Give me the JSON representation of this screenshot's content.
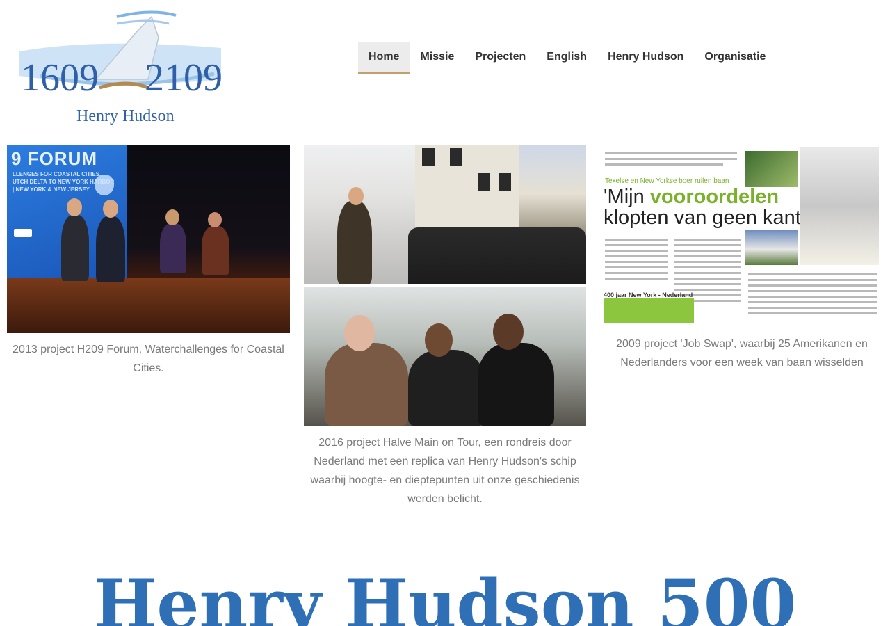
{
  "header": {
    "logo": {
      "year_left": "1609",
      "year_right": "2109",
      "name": "Henry Hudson"
    }
  },
  "nav": {
    "items": [
      {
        "label": "Home",
        "active": true
      },
      {
        "label": "Missie",
        "active": false
      },
      {
        "label": "Projecten",
        "active": false
      },
      {
        "label": "English",
        "active": false
      },
      {
        "label": "Henry Hudson",
        "active": false
      },
      {
        "label": "Organisatie",
        "active": false
      }
    ],
    "accent_color": "#c3a06b"
  },
  "gallery": [
    {
      "caption": "2013 project H209 Forum, Waterchallenges for Coastal Cities.",
      "photo_text": {
        "screen_title": "9 FORUM",
        "screen_sub": "LLENGES FOR COASTAL CITIES\nUTCH DELTA TO NEW YORK HARBOR\n| NEW YORK & NEW JERSEY"
      }
    },
    {
      "caption": "2016 project Halve Main on Tour, een rondreis door Nederland met een replica van Henry Hudson's schip waarbij hoogte- en dieptepunten uit onze geschiedenis werden belicht."
    },
    {
      "caption": "2009 project 'Job Swap', waarbij 25 Amerikanen en Nederlanders voor een week van baan wisselden",
      "photo_text": {
        "kicker": "Texelse en New Yorkse boer ruilen baan",
        "headline_a": "'Mijn ",
        "headline_green": "vooroordelen",
        "headline_b": "klopten van geen kant'",
        "box_title": "400 jaar New York - Nederland"
      }
    }
  ],
  "footer_title": "Henry Hudson 500",
  "colors": {
    "logo_blue": "#2e5fa8",
    "title_blue": "#2f6fb6",
    "caption_gray": "#7a7a7a"
  }
}
